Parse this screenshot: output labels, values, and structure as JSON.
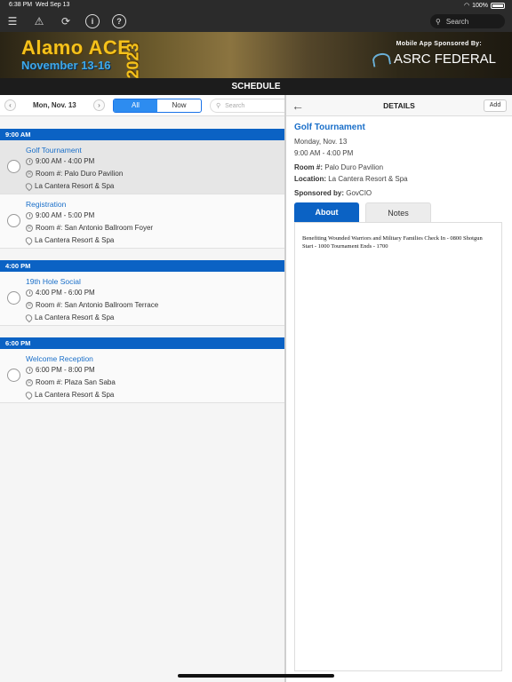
{
  "status": {
    "time": "6:38 PM",
    "date": "Wed Sep 13",
    "battery": "100%"
  },
  "toolbar": {
    "search_placeholder": "Search"
  },
  "banner": {
    "title": "Alamo ACE",
    "dates": "November 13-16",
    "year": "2023",
    "sponsor_text": "Mobile App Sponsored By:",
    "sponsor_name": "ASRC FEDERAL"
  },
  "schedule_title": "SCHEDULE",
  "left": {
    "date": "Mon, Nov. 13",
    "filter_all": "All",
    "filter_now": "Now",
    "search_placeholder": "Search",
    "groups": [
      {
        "time": "9:00 AM"
      },
      {
        "time": "4:00 PM"
      },
      {
        "time": "6:00 PM"
      }
    ],
    "events": [
      {
        "title": "Golf Tournament",
        "time": "9:00 AM - 4:00 PM",
        "room": "Room #: Palo Duro Pavilion",
        "location": "La Cantera Resort & Spa"
      },
      {
        "title": "Registration",
        "time": "9:00 AM - 5:00 PM",
        "room": "Room #: San Antonio Ballroom Foyer",
        "location": "La Cantera Resort & Spa"
      },
      {
        "title": "19th Hole Social",
        "time": "4:00 PM - 6:00 PM",
        "room": "Room #: San Antonio Ballroom Terrace",
        "location": "La Cantera Resort & Spa"
      },
      {
        "title": "Welcome Reception",
        "time": "6:00 PM - 8:00 PM",
        "room": "Room #: Plaza San Saba",
        "location": "La Cantera Resort & Spa"
      }
    ]
  },
  "details": {
    "header": "DETAILS",
    "add": "Add",
    "title": "Golf Tournament",
    "date": "Monday, Nov. 13",
    "time": "9:00 AM - 4:00 PM",
    "room_label": "Room #:",
    "room": "Palo Duro Pavilion",
    "location_label": "Location:",
    "location": "La Cantera Resort & Spa",
    "sponsor_label": "Sponsored by:",
    "sponsor": "GovCIO",
    "tab_about": "About",
    "tab_notes": "Notes",
    "about_text": "Benefiting Wounded Warriors and Military Families Check In - 0800 Shotgun Start - 1000 Tournament Ends - 1700"
  },
  "colors": {
    "accent": "#0b62c4",
    "link": "#1a6fc9",
    "banner_gold": "#f5c21b"
  }
}
